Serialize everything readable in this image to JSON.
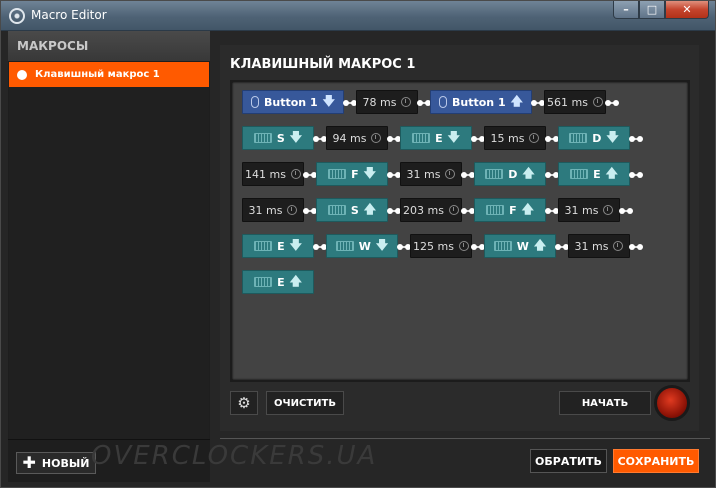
{
  "window": {
    "title": "Macro Editor",
    "min": "–",
    "max": "□",
    "close": "✕"
  },
  "sidebar": {
    "header": "МАКРОСЫ",
    "items": [
      {
        "label": "Клавишный макрос 1",
        "selected": true
      }
    ],
    "new_button": "НОВЫЙ"
  },
  "main": {
    "title": "КЛАВИШНЫЙ МАКРОС 1",
    "clear_button": "ОЧИСТИТЬ",
    "start_button": "НАЧАТЬ"
  },
  "watermark": "OVERCLOCKERS.UA",
  "footer": {
    "revert_button": "ОБРАТИТЬ",
    "save_button": "СОХРАНИТЬ"
  },
  "macro_rows": [
    [
      {
        "type": "mouse",
        "label": "Button 1",
        "dir": "down"
      },
      {
        "type": "delay",
        "label": "78 ms"
      },
      {
        "type": "mouse",
        "label": "Button 1",
        "dir": "up"
      },
      {
        "type": "delay",
        "label": "561 ms"
      }
    ],
    [
      {
        "type": "key",
        "label": "S",
        "dir": "down"
      },
      {
        "type": "delay",
        "label": "94 ms"
      },
      {
        "type": "key",
        "label": "E",
        "dir": "down"
      },
      {
        "type": "delay",
        "label": "15 ms"
      },
      {
        "type": "key",
        "label": "D",
        "dir": "down"
      }
    ],
    [
      {
        "type": "delay",
        "label": "141 ms"
      },
      {
        "type": "key",
        "label": "F",
        "dir": "down"
      },
      {
        "type": "delay",
        "label": "31 ms"
      },
      {
        "type": "key",
        "label": "D",
        "dir": "up"
      },
      {
        "type": "key",
        "label": "E",
        "dir": "up"
      }
    ],
    [
      {
        "type": "delay",
        "label": "31 ms"
      },
      {
        "type": "key",
        "label": "S",
        "dir": "up"
      },
      {
        "type": "delay",
        "label": "203 ms"
      },
      {
        "type": "key",
        "label": "F",
        "dir": "up"
      },
      {
        "type": "delay",
        "label": "31 ms"
      }
    ],
    [
      {
        "type": "key",
        "label": "E",
        "dir": "down"
      },
      {
        "type": "key",
        "label": "W",
        "dir": "down"
      },
      {
        "type": "delay",
        "label": "125 ms"
      },
      {
        "type": "key",
        "label": "W",
        "dir": "up"
      },
      {
        "type": "delay",
        "label": "31 ms"
      }
    ],
    [
      {
        "type": "key",
        "label": "E",
        "dir": "up"
      }
    ]
  ]
}
